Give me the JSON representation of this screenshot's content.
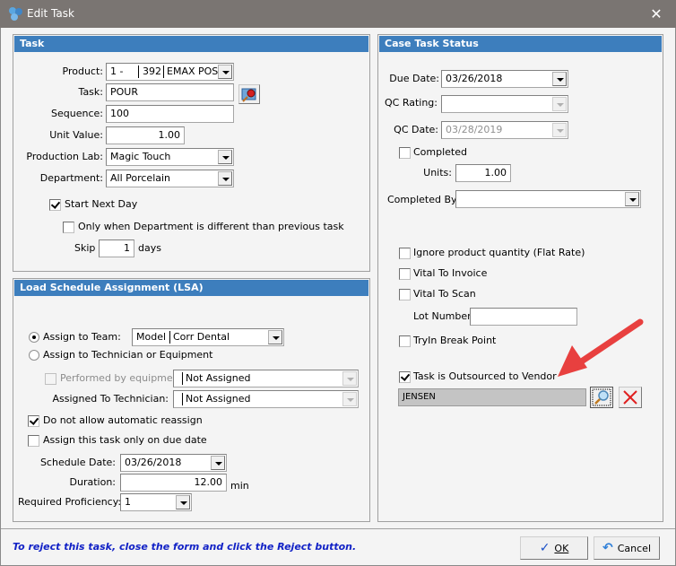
{
  "window": {
    "title": "Edit Task",
    "close_icon": "close-icon"
  },
  "task_panel": {
    "header": "Task",
    "product_label": "Product:",
    "product_code": "1 -",
    "product_number": "392",
    "product_name": "EMAX POSTI",
    "task_label": "Task:",
    "task_value": "POUR",
    "sequence_label": "Sequence:",
    "sequence_value": "100",
    "unit_value_label": "Unit Value:",
    "unit_value": "1.00",
    "production_lab_label": "Production Lab:",
    "production_lab_value": "Magic Touch",
    "department_label": "Department:",
    "department_value": "All Porcelain",
    "start_next_day_label": "Start Next Day",
    "start_next_day_checked": true,
    "only_when_dept_label": "Only when Department is different than previous task",
    "only_when_dept_checked": false,
    "skip_label": "Skip",
    "skip_value": "1",
    "days_label": "days"
  },
  "lsa_panel": {
    "header": "Load Schedule Assignment (LSA)",
    "assign_team_label": "Assign to Team:",
    "assign_team_selected": true,
    "team_code": "Model",
    "team_name": "Corr Dental",
    "assign_tech_label": "Assign to Technician or Equipment",
    "assign_tech_selected": false,
    "performed_by_label": "Performed by equipment:",
    "performed_by_value": "Not Assigned",
    "assigned_tech_label": "Assigned To Technician:",
    "assigned_tech_value": "Not Assigned",
    "no_reassign_label": "Do not allow automatic reassign",
    "no_reassign_checked": true,
    "only_due_date_label": "Assign this task only on due date",
    "only_due_date_checked": false,
    "schedule_date_label": "Schedule Date:",
    "schedule_date_value": "03/26/2018",
    "duration_label": "Duration:",
    "duration_value": "12.00",
    "duration_unit": "min",
    "proficiency_label": "Required Proficiency:",
    "proficiency_value": "1"
  },
  "status_panel": {
    "header": "Case Task Status",
    "due_date_label": "Due Date:",
    "due_date_value": "03/26/2018",
    "qc_rating_label": "QC Rating:",
    "qc_rating_value": "",
    "qc_date_label": "QC Date:",
    "qc_date_value": "03/28/2019",
    "completed_label": "Completed",
    "completed_checked": false,
    "units_label": "Units:",
    "units_value": "1.00",
    "completed_by_label": "Completed By:",
    "completed_by_value": "",
    "ignore_qty_label": "Ignore product quantity (Flat Rate)",
    "vital_invoice_label": "Vital To Invoice",
    "vital_scan_label": "Vital To Scan",
    "lot_number_label": "Lot Number:",
    "lot_number_value": "",
    "tryin_label": "TryIn Break Point",
    "outsourced_label": "Task is Outsourced to Vendor",
    "outsourced_checked": true,
    "vendor_value": "JENSEN"
  },
  "footer": {
    "message": "To reject this task, close the form and click the Reject button.",
    "ok_label": "OK",
    "cancel_label": "Cancel"
  },
  "colors": {
    "header_blue": "#3d7ebd",
    "message_blue": "#1222c6",
    "annotation_arrow": "#e8403f"
  }
}
